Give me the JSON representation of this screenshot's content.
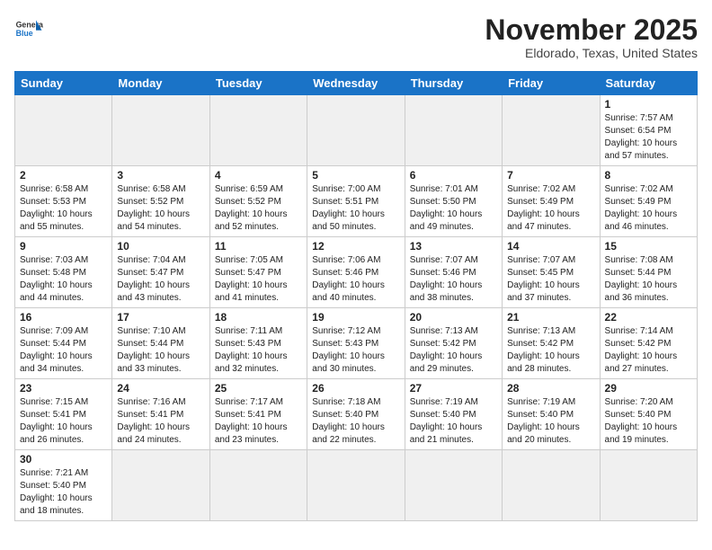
{
  "header": {
    "logo_general": "General",
    "logo_blue": "Blue",
    "month_title": "November 2025",
    "location": "Eldorado, Texas, United States"
  },
  "days_of_week": [
    "Sunday",
    "Monday",
    "Tuesday",
    "Wednesday",
    "Thursday",
    "Friday",
    "Saturday"
  ],
  "weeks": [
    [
      {
        "day": "",
        "info": ""
      },
      {
        "day": "",
        "info": ""
      },
      {
        "day": "",
        "info": ""
      },
      {
        "day": "",
        "info": ""
      },
      {
        "day": "",
        "info": ""
      },
      {
        "day": "",
        "info": ""
      },
      {
        "day": "1",
        "info": "Sunrise: 7:57 AM\nSunset: 6:54 PM\nDaylight: 10 hours and 57 minutes."
      }
    ],
    [
      {
        "day": "2",
        "info": "Sunrise: 6:58 AM\nSunset: 5:53 PM\nDaylight: 10 hours and 55 minutes."
      },
      {
        "day": "3",
        "info": "Sunrise: 6:58 AM\nSunset: 5:52 PM\nDaylight: 10 hours and 54 minutes."
      },
      {
        "day": "4",
        "info": "Sunrise: 6:59 AM\nSunset: 5:52 PM\nDaylight: 10 hours and 52 minutes."
      },
      {
        "day": "5",
        "info": "Sunrise: 7:00 AM\nSunset: 5:51 PM\nDaylight: 10 hours and 50 minutes."
      },
      {
        "day": "6",
        "info": "Sunrise: 7:01 AM\nSunset: 5:50 PM\nDaylight: 10 hours and 49 minutes."
      },
      {
        "day": "7",
        "info": "Sunrise: 7:02 AM\nSunset: 5:49 PM\nDaylight: 10 hours and 47 minutes."
      },
      {
        "day": "8",
        "info": "Sunrise: 7:02 AM\nSunset: 5:49 PM\nDaylight: 10 hours and 46 minutes."
      }
    ],
    [
      {
        "day": "9",
        "info": "Sunrise: 7:03 AM\nSunset: 5:48 PM\nDaylight: 10 hours and 44 minutes."
      },
      {
        "day": "10",
        "info": "Sunrise: 7:04 AM\nSunset: 5:47 PM\nDaylight: 10 hours and 43 minutes."
      },
      {
        "day": "11",
        "info": "Sunrise: 7:05 AM\nSunset: 5:47 PM\nDaylight: 10 hours and 41 minutes."
      },
      {
        "day": "12",
        "info": "Sunrise: 7:06 AM\nSunset: 5:46 PM\nDaylight: 10 hours and 40 minutes."
      },
      {
        "day": "13",
        "info": "Sunrise: 7:07 AM\nSunset: 5:46 PM\nDaylight: 10 hours and 38 minutes."
      },
      {
        "day": "14",
        "info": "Sunrise: 7:07 AM\nSunset: 5:45 PM\nDaylight: 10 hours and 37 minutes."
      },
      {
        "day": "15",
        "info": "Sunrise: 7:08 AM\nSunset: 5:44 PM\nDaylight: 10 hours and 36 minutes."
      }
    ],
    [
      {
        "day": "16",
        "info": "Sunrise: 7:09 AM\nSunset: 5:44 PM\nDaylight: 10 hours and 34 minutes."
      },
      {
        "day": "17",
        "info": "Sunrise: 7:10 AM\nSunset: 5:44 PM\nDaylight: 10 hours and 33 minutes."
      },
      {
        "day": "18",
        "info": "Sunrise: 7:11 AM\nSunset: 5:43 PM\nDaylight: 10 hours and 32 minutes."
      },
      {
        "day": "19",
        "info": "Sunrise: 7:12 AM\nSunset: 5:43 PM\nDaylight: 10 hours and 30 minutes."
      },
      {
        "day": "20",
        "info": "Sunrise: 7:13 AM\nSunset: 5:42 PM\nDaylight: 10 hours and 29 minutes."
      },
      {
        "day": "21",
        "info": "Sunrise: 7:13 AM\nSunset: 5:42 PM\nDaylight: 10 hours and 28 minutes."
      },
      {
        "day": "22",
        "info": "Sunrise: 7:14 AM\nSunset: 5:42 PM\nDaylight: 10 hours and 27 minutes."
      }
    ],
    [
      {
        "day": "23",
        "info": "Sunrise: 7:15 AM\nSunset: 5:41 PM\nDaylight: 10 hours and 26 minutes."
      },
      {
        "day": "24",
        "info": "Sunrise: 7:16 AM\nSunset: 5:41 PM\nDaylight: 10 hours and 24 minutes."
      },
      {
        "day": "25",
        "info": "Sunrise: 7:17 AM\nSunset: 5:41 PM\nDaylight: 10 hours and 23 minutes."
      },
      {
        "day": "26",
        "info": "Sunrise: 7:18 AM\nSunset: 5:40 PM\nDaylight: 10 hours and 22 minutes."
      },
      {
        "day": "27",
        "info": "Sunrise: 7:19 AM\nSunset: 5:40 PM\nDaylight: 10 hours and 21 minutes."
      },
      {
        "day": "28",
        "info": "Sunrise: 7:19 AM\nSunset: 5:40 PM\nDaylight: 10 hours and 20 minutes."
      },
      {
        "day": "29",
        "info": "Sunrise: 7:20 AM\nSunset: 5:40 PM\nDaylight: 10 hours and 19 minutes."
      }
    ],
    [
      {
        "day": "30",
        "info": "Sunrise: 7:21 AM\nSunset: 5:40 PM\nDaylight: 10 hours and 18 minutes."
      },
      {
        "day": "",
        "info": ""
      },
      {
        "day": "",
        "info": ""
      },
      {
        "day": "",
        "info": ""
      },
      {
        "day": "",
        "info": ""
      },
      {
        "day": "",
        "info": ""
      },
      {
        "day": "",
        "info": ""
      }
    ]
  ]
}
